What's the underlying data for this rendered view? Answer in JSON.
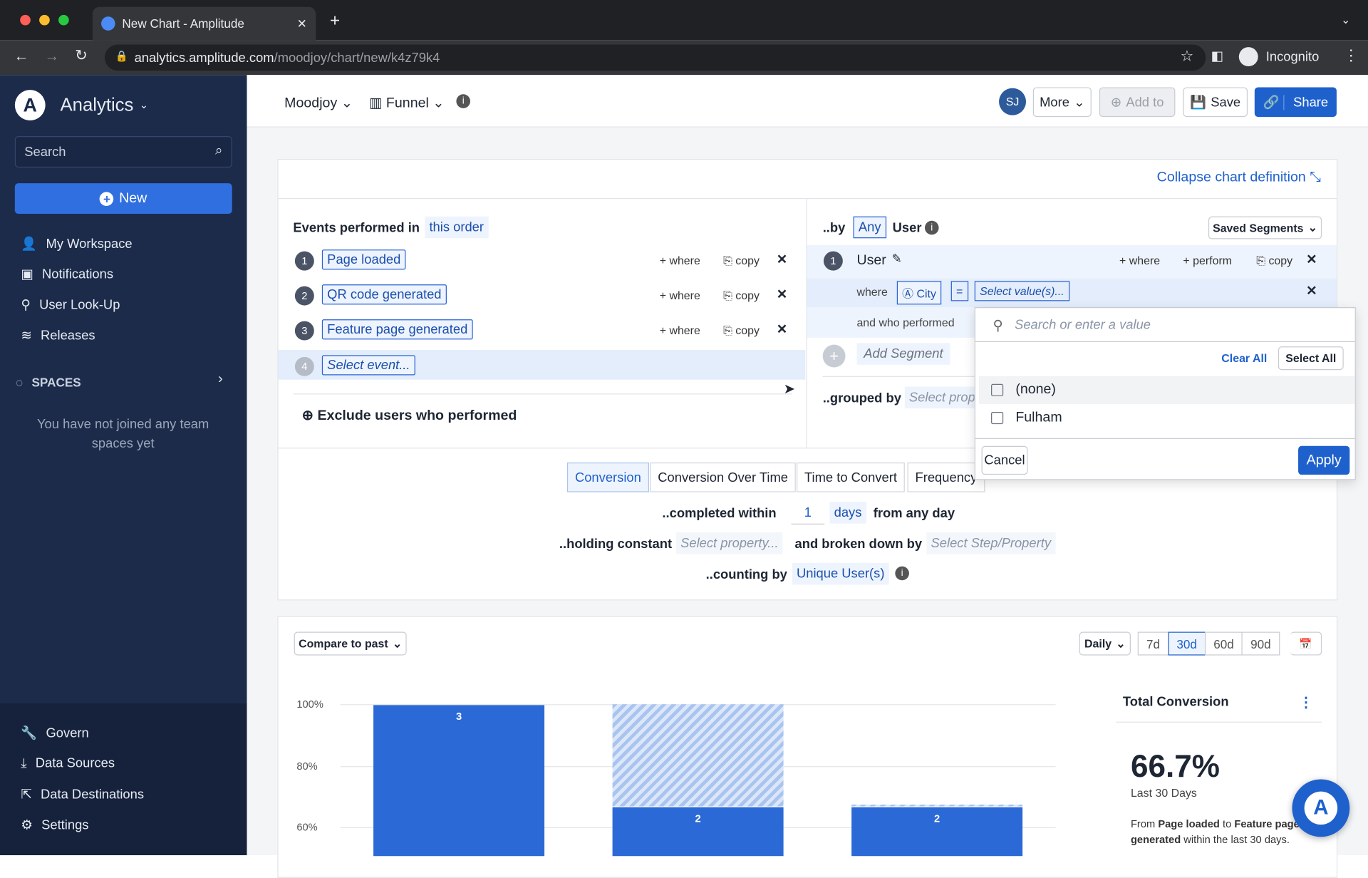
{
  "browser": {
    "tab_title": "New Chart - Amplitude",
    "url_host": "analytics.amplitude.com",
    "url_path": "/moodjoy/chart/new/k4z79k4",
    "profile": "Incognito"
  },
  "sidebar": {
    "app": "Analytics",
    "search_placeholder": "Search",
    "new_label": "New",
    "items": [
      {
        "label": "My Workspace",
        "icon": "user-icon"
      },
      {
        "label": "Notifications",
        "icon": "inbox-icon"
      },
      {
        "label": "User Look-Up",
        "icon": "user-search-icon"
      },
      {
        "label": "Releases",
        "icon": "releases-icon"
      }
    ],
    "spaces_label": "SPACES",
    "spaces_empty": "You have not joined any team spaces yet",
    "bottom": [
      {
        "label": "Govern",
        "icon": "wrench-icon"
      },
      {
        "label": "Data Sources",
        "icon": "download-icon"
      },
      {
        "label": "Data Destinations",
        "icon": "export-icon"
      },
      {
        "label": "Settings",
        "icon": "gear-icon"
      }
    ]
  },
  "topbar": {
    "project": "Moodjoy",
    "chart_type": "Funnel",
    "avatar": "SJ",
    "more": "More",
    "add_to": "Add to",
    "save": "Save",
    "share": "Share"
  },
  "definition": {
    "collapse": "Collapse chart definition",
    "events_label": "Events performed in",
    "order": "this order",
    "events": [
      {
        "n": "1",
        "name": "Page loaded"
      },
      {
        "n": "2",
        "name": "QR code generated"
      },
      {
        "n": "3",
        "name": "Feature page generated"
      }
    ],
    "select_event_n": "4",
    "select_event": "Select event...",
    "where": "where",
    "copy": "copy",
    "exclude": "Exclude users who performed",
    "by": "..by",
    "any": "Any",
    "user": "User",
    "saved_segments": "Saved Segments",
    "segment_n": "1",
    "segment_name": "User",
    "perform": "perform",
    "where_label": "where",
    "city": "City",
    "eq": "=",
    "select_values": "Select value(s)...",
    "and_who_performed": "and who performed",
    "add_segment": "Add Segment",
    "grouped_by": "..grouped by",
    "select_prop": "Select property...",
    "tabs": [
      "Conversion",
      "Conversion Over Time",
      "Time to Convert",
      "Frequency"
    ],
    "completed_within": "..completed within",
    "days_value": "1",
    "days": "days",
    "from_any_day": "from any day",
    "holding_constant": "..holding constant",
    "select_property": "Select property...",
    "broken_down_by": "and broken down by",
    "select_step": "Select Step/Property",
    "counting_by": "..counting by",
    "unique_users": "Unique User(s)"
  },
  "dropdown": {
    "search_placeholder": "Search or enter a value",
    "clear_all": "Clear All",
    "select_all": "Select All",
    "options": [
      {
        "label": "(none)",
        "checked": false
      },
      {
        "label": "Fulham",
        "checked": false
      }
    ],
    "cancel": "Cancel",
    "apply": "Apply"
  },
  "chart_controls": {
    "compare": "Compare to past",
    "interval": "Daily",
    "ranges": [
      "7d",
      "30d",
      "60d",
      "90d"
    ],
    "active_range": "30d"
  },
  "chart_data": {
    "type": "bar",
    "yticks": [
      "100%",
      "80%",
      "60%"
    ],
    "ylim": [
      50,
      100
    ],
    "categories": [
      "Page loaded",
      "QR code generated",
      "Feature page generated"
    ],
    "values": [
      100,
      66.7,
      66.7
    ],
    "counts": [
      "3",
      "2",
      "2"
    ],
    "dropoff_top": [
      null,
      100,
      67.5
    ]
  },
  "summary": {
    "title": "Total Conversion",
    "value": "66.7%",
    "period": "Last 30 Days",
    "desc_from": "From",
    "step1": "Page loaded",
    "desc_to": "to",
    "step2": "Feature page generated",
    "desc_end": "within the last 30 days."
  },
  "colors": {
    "brand": "#1e61cd",
    "sidebar": "#1c2b4a",
    "bar": "#2b69d6"
  }
}
